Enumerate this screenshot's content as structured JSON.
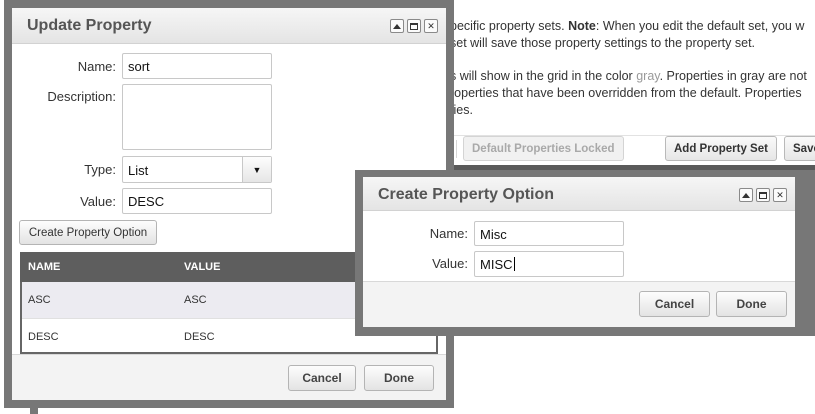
{
  "background": {
    "help_line1_pre": "pecific property sets. ",
    "help_line1_bold": "Note",
    "help_line1_post": ": When you edit the default set, you w",
    "help_line2": "set will save those property settings to the property set.",
    "help_line3_pre": "s will show in the grid in the color ",
    "help_line3_gray": "gray",
    "help_line3_post": ". Properties in gray are not",
    "help_line4": "roperties that have been overridden from the default. Properties",
    "help_line5": "ties.",
    "buttons": {
      "default_locked": "Default Properties Locked",
      "add_set": "Add Property Set",
      "save": "Save"
    }
  },
  "update_dialog": {
    "title": "Update Property",
    "name_label": "Name:",
    "name_value": "sort",
    "description_label": "Description:",
    "description_value": "",
    "type_label": "Type:",
    "type_value": "List",
    "value_label": "Value:",
    "value_value": "DESC",
    "create_option_button": "Create Property Option",
    "grid": {
      "columns": [
        "NAME",
        "VALUE"
      ],
      "rows": [
        {
          "name": "ASC",
          "value": "ASC"
        },
        {
          "name": "DESC",
          "value": "DESC"
        }
      ]
    },
    "cancel_button": "Cancel",
    "done_button": "Done"
  },
  "create_dialog": {
    "title": "Create Property Option",
    "name_label": "Name:",
    "name_value": "Misc",
    "value_label": "Value:",
    "value_value": "MISC",
    "cancel_button": "Cancel",
    "done_button": "Done"
  },
  "colors": {
    "frame": "#777777",
    "grid_header": "#5e5e5e",
    "row_highlight": "#ecebf1"
  }
}
